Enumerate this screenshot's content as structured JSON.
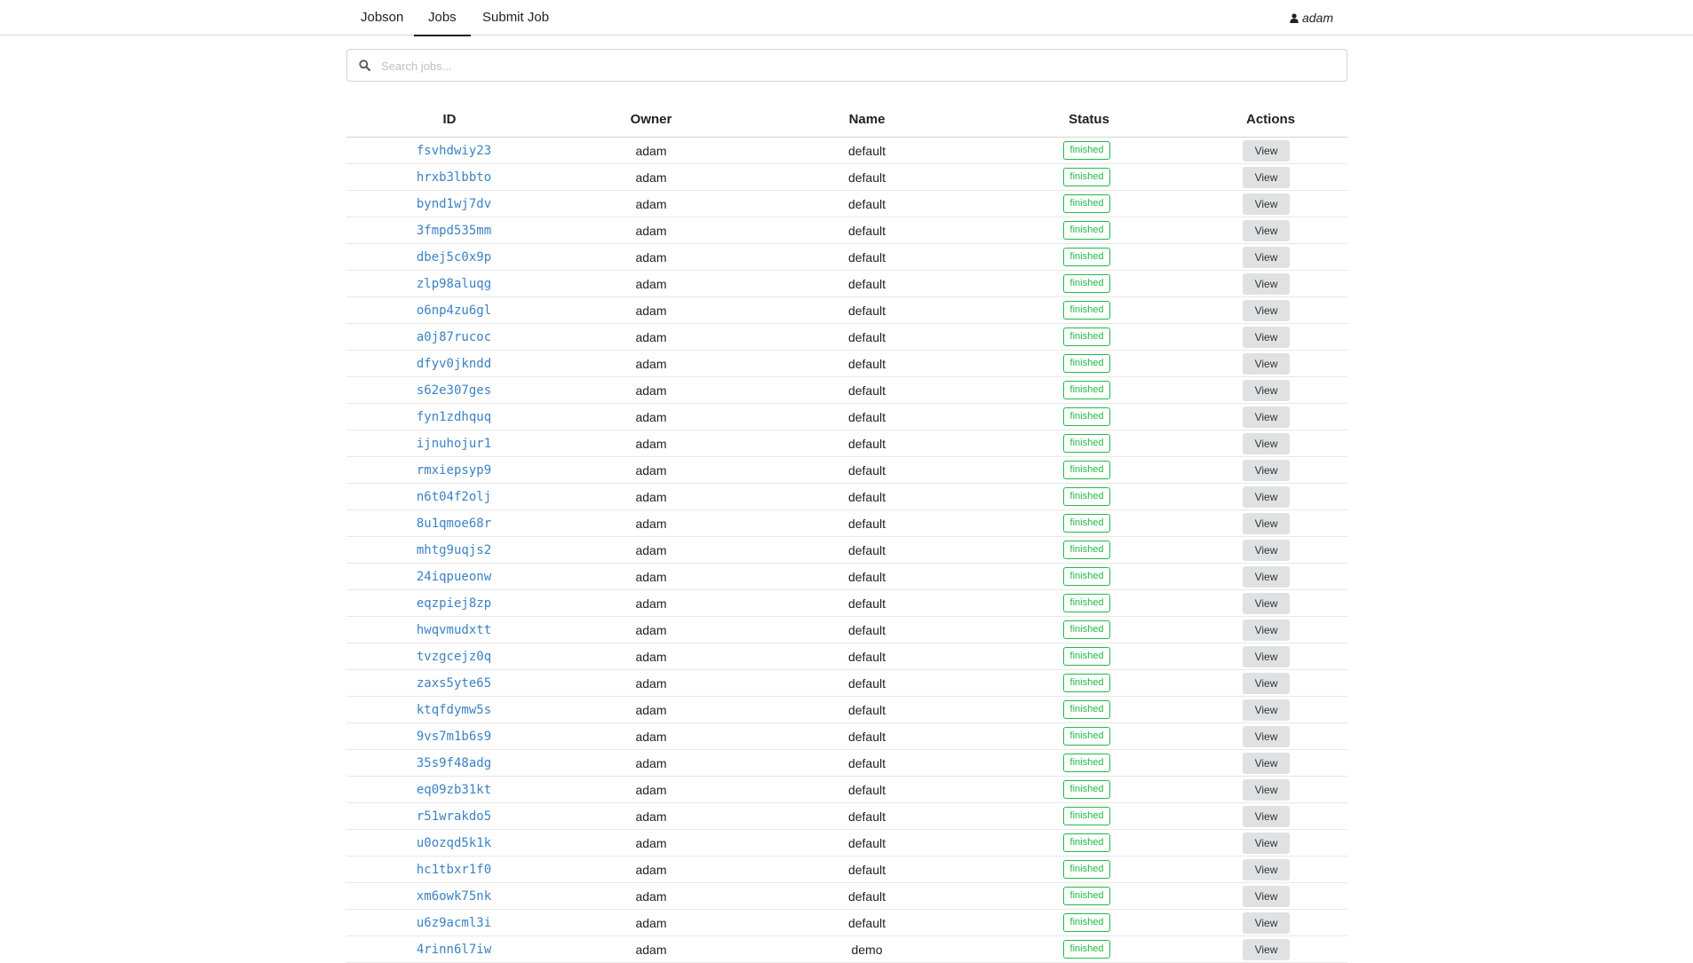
{
  "nav": {
    "brand": "Jobson",
    "jobs": "Jobs",
    "submit": "Submit Job",
    "user": "adam"
  },
  "search": {
    "placeholder": "Search jobs..."
  },
  "table": {
    "headers": [
      "ID",
      "Owner",
      "Name",
      "Status",
      "Actions"
    ],
    "action_label": "View",
    "rows": [
      {
        "id": "fsvhdwiy23",
        "owner": "adam",
        "name": "default",
        "status": "finished"
      },
      {
        "id": "hrxb3lbbto",
        "owner": "adam",
        "name": "default",
        "status": "finished"
      },
      {
        "id": "bynd1wj7dv",
        "owner": "adam",
        "name": "default",
        "status": "finished"
      },
      {
        "id": "3fmpd535mm",
        "owner": "adam",
        "name": "default",
        "status": "finished"
      },
      {
        "id": "dbej5c0x9p",
        "owner": "adam",
        "name": "default",
        "status": "finished"
      },
      {
        "id": "zlp98aluqg",
        "owner": "adam",
        "name": "default",
        "status": "finished"
      },
      {
        "id": "o6np4zu6gl",
        "owner": "adam",
        "name": "default",
        "status": "finished"
      },
      {
        "id": "a0j87rucoc",
        "owner": "adam",
        "name": "default",
        "status": "finished"
      },
      {
        "id": "dfyv0jkndd",
        "owner": "adam",
        "name": "default",
        "status": "finished"
      },
      {
        "id": "s62e307ges",
        "owner": "adam",
        "name": "default",
        "status": "finished"
      },
      {
        "id": "fyn1zdhquq",
        "owner": "adam",
        "name": "default",
        "status": "finished"
      },
      {
        "id": "ijnuhojur1",
        "owner": "adam",
        "name": "default",
        "status": "finished"
      },
      {
        "id": "rmxiepsyp9",
        "owner": "adam",
        "name": "default",
        "status": "finished"
      },
      {
        "id": "n6t04f2olj",
        "owner": "adam",
        "name": "default",
        "status": "finished"
      },
      {
        "id": "8u1qmoe68r",
        "owner": "adam",
        "name": "default",
        "status": "finished"
      },
      {
        "id": "mhtg9uqjs2",
        "owner": "adam",
        "name": "default",
        "status": "finished"
      },
      {
        "id": "24iqpueonw",
        "owner": "adam",
        "name": "default",
        "status": "finished"
      },
      {
        "id": "eqzpiej8zp",
        "owner": "adam",
        "name": "default",
        "status": "finished"
      },
      {
        "id": "hwqvmudxtt",
        "owner": "adam",
        "name": "default",
        "status": "finished"
      },
      {
        "id": "tvzgcejz0q",
        "owner": "adam",
        "name": "default",
        "status": "finished"
      },
      {
        "id": "zaxs5yte65",
        "owner": "adam",
        "name": "default",
        "status": "finished"
      },
      {
        "id": "ktqfdymw5s",
        "owner": "adam",
        "name": "default",
        "status": "finished"
      },
      {
        "id": "9vs7m1b6s9",
        "owner": "adam",
        "name": "default",
        "status": "finished"
      },
      {
        "id": "35s9f48adg",
        "owner": "adam",
        "name": "default",
        "status": "finished"
      },
      {
        "id": "eq09zb31kt",
        "owner": "adam",
        "name": "default",
        "status": "finished"
      },
      {
        "id": "r51wrakdo5",
        "owner": "adam",
        "name": "default",
        "status": "finished"
      },
      {
        "id": "u0ozqd5k1k",
        "owner": "adam",
        "name": "default",
        "status": "finished"
      },
      {
        "id": "hc1tbxr1f0",
        "owner": "adam",
        "name": "default",
        "status": "finished"
      },
      {
        "id": "xm6owk75nk",
        "owner": "adam",
        "name": "default",
        "status": "finished"
      },
      {
        "id": "u6z9acml3i",
        "owner": "adam",
        "name": "default",
        "status": "finished"
      },
      {
        "id": "4rinn6l7iw",
        "owner": "adam",
        "name": "demo",
        "status": "finished"
      }
    ]
  },
  "colors": {
    "link": "#3b82c4",
    "status_finished": "#21ba45",
    "button_bg": "#e0e1e2"
  }
}
